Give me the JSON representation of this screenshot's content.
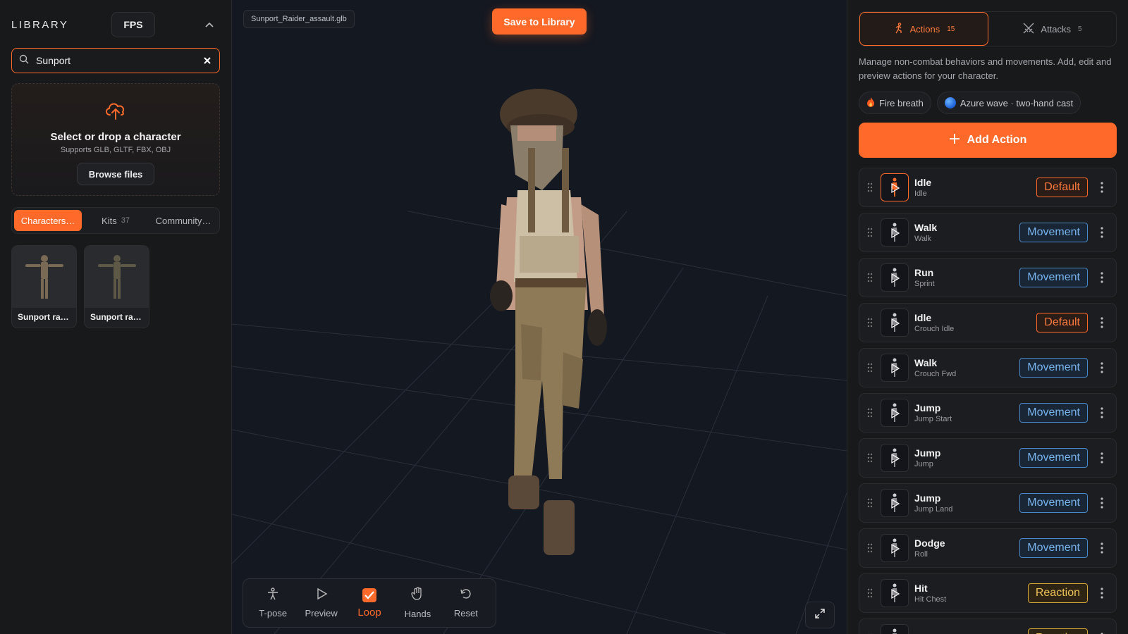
{
  "library": {
    "title": "LIBRARY",
    "mode_button": "FPS",
    "search": {
      "value": "Sunport",
      "placeholder": "Search"
    },
    "dropzone": {
      "title": "Select or drop a character",
      "subtitle": "Supports GLB, GLTF, FBX, OBJ",
      "browse_label": "Browse files"
    },
    "tabs": [
      {
        "label": "Characters…",
        "count": ""
      },
      {
        "label": "Kits",
        "count": "37"
      },
      {
        "label": "Community…",
        "count": ""
      }
    ],
    "cards": [
      {
        "label": "Sunport rai…"
      },
      {
        "label": "Sunport rai…"
      }
    ]
  },
  "viewport": {
    "file_name": "Sunport_Raider_assault.glb",
    "save_label": "Save to Library",
    "toolbar": [
      {
        "label": "T-pose",
        "icon": "person-icon"
      },
      {
        "label": "Preview",
        "icon": "play-icon"
      },
      {
        "label": "Loop",
        "icon": "check-icon"
      },
      {
        "label": "Hands",
        "icon": "hand-icon"
      },
      {
        "label": "Reset",
        "icon": "reset-icon"
      }
    ]
  },
  "panel": {
    "tabs": [
      {
        "label": "Actions",
        "count": "15"
      },
      {
        "label": "Attacks",
        "count": "5"
      }
    ],
    "description": "Manage non-combat behaviors and movements. Add, edit and preview actions for your character.",
    "chips": [
      {
        "label": "Fire breath"
      },
      {
        "label": "Azure wave · two-hand cast"
      }
    ],
    "add_label": "Add Action",
    "actions": [
      {
        "name": "Idle",
        "sub": "Idle",
        "tag": "Default"
      },
      {
        "name": "Walk",
        "sub": "Walk",
        "tag": "Movement"
      },
      {
        "name": "Run",
        "sub": "Sprint",
        "tag": "Movement"
      },
      {
        "name": "Idle",
        "sub": "Crouch Idle",
        "tag": "Default"
      },
      {
        "name": "Walk",
        "sub": "Crouch Fwd",
        "tag": "Movement"
      },
      {
        "name": "Jump",
        "sub": "Jump Start",
        "tag": "Movement"
      },
      {
        "name": "Jump",
        "sub": "Jump",
        "tag": "Movement"
      },
      {
        "name": "Jump",
        "sub": "Jump Land",
        "tag": "Movement"
      },
      {
        "name": "Dodge",
        "sub": "Roll",
        "tag": "Movement"
      },
      {
        "name": "Hit",
        "sub": "Hit Chest",
        "tag": "Reaction"
      },
      {
        "name": "Hit",
        "sub": "",
        "tag": "Reaction"
      }
    ]
  },
  "colors": {
    "accent": "#ff6a2b",
    "movement": "#79b4ef",
    "reaction": "#f0c35a"
  }
}
